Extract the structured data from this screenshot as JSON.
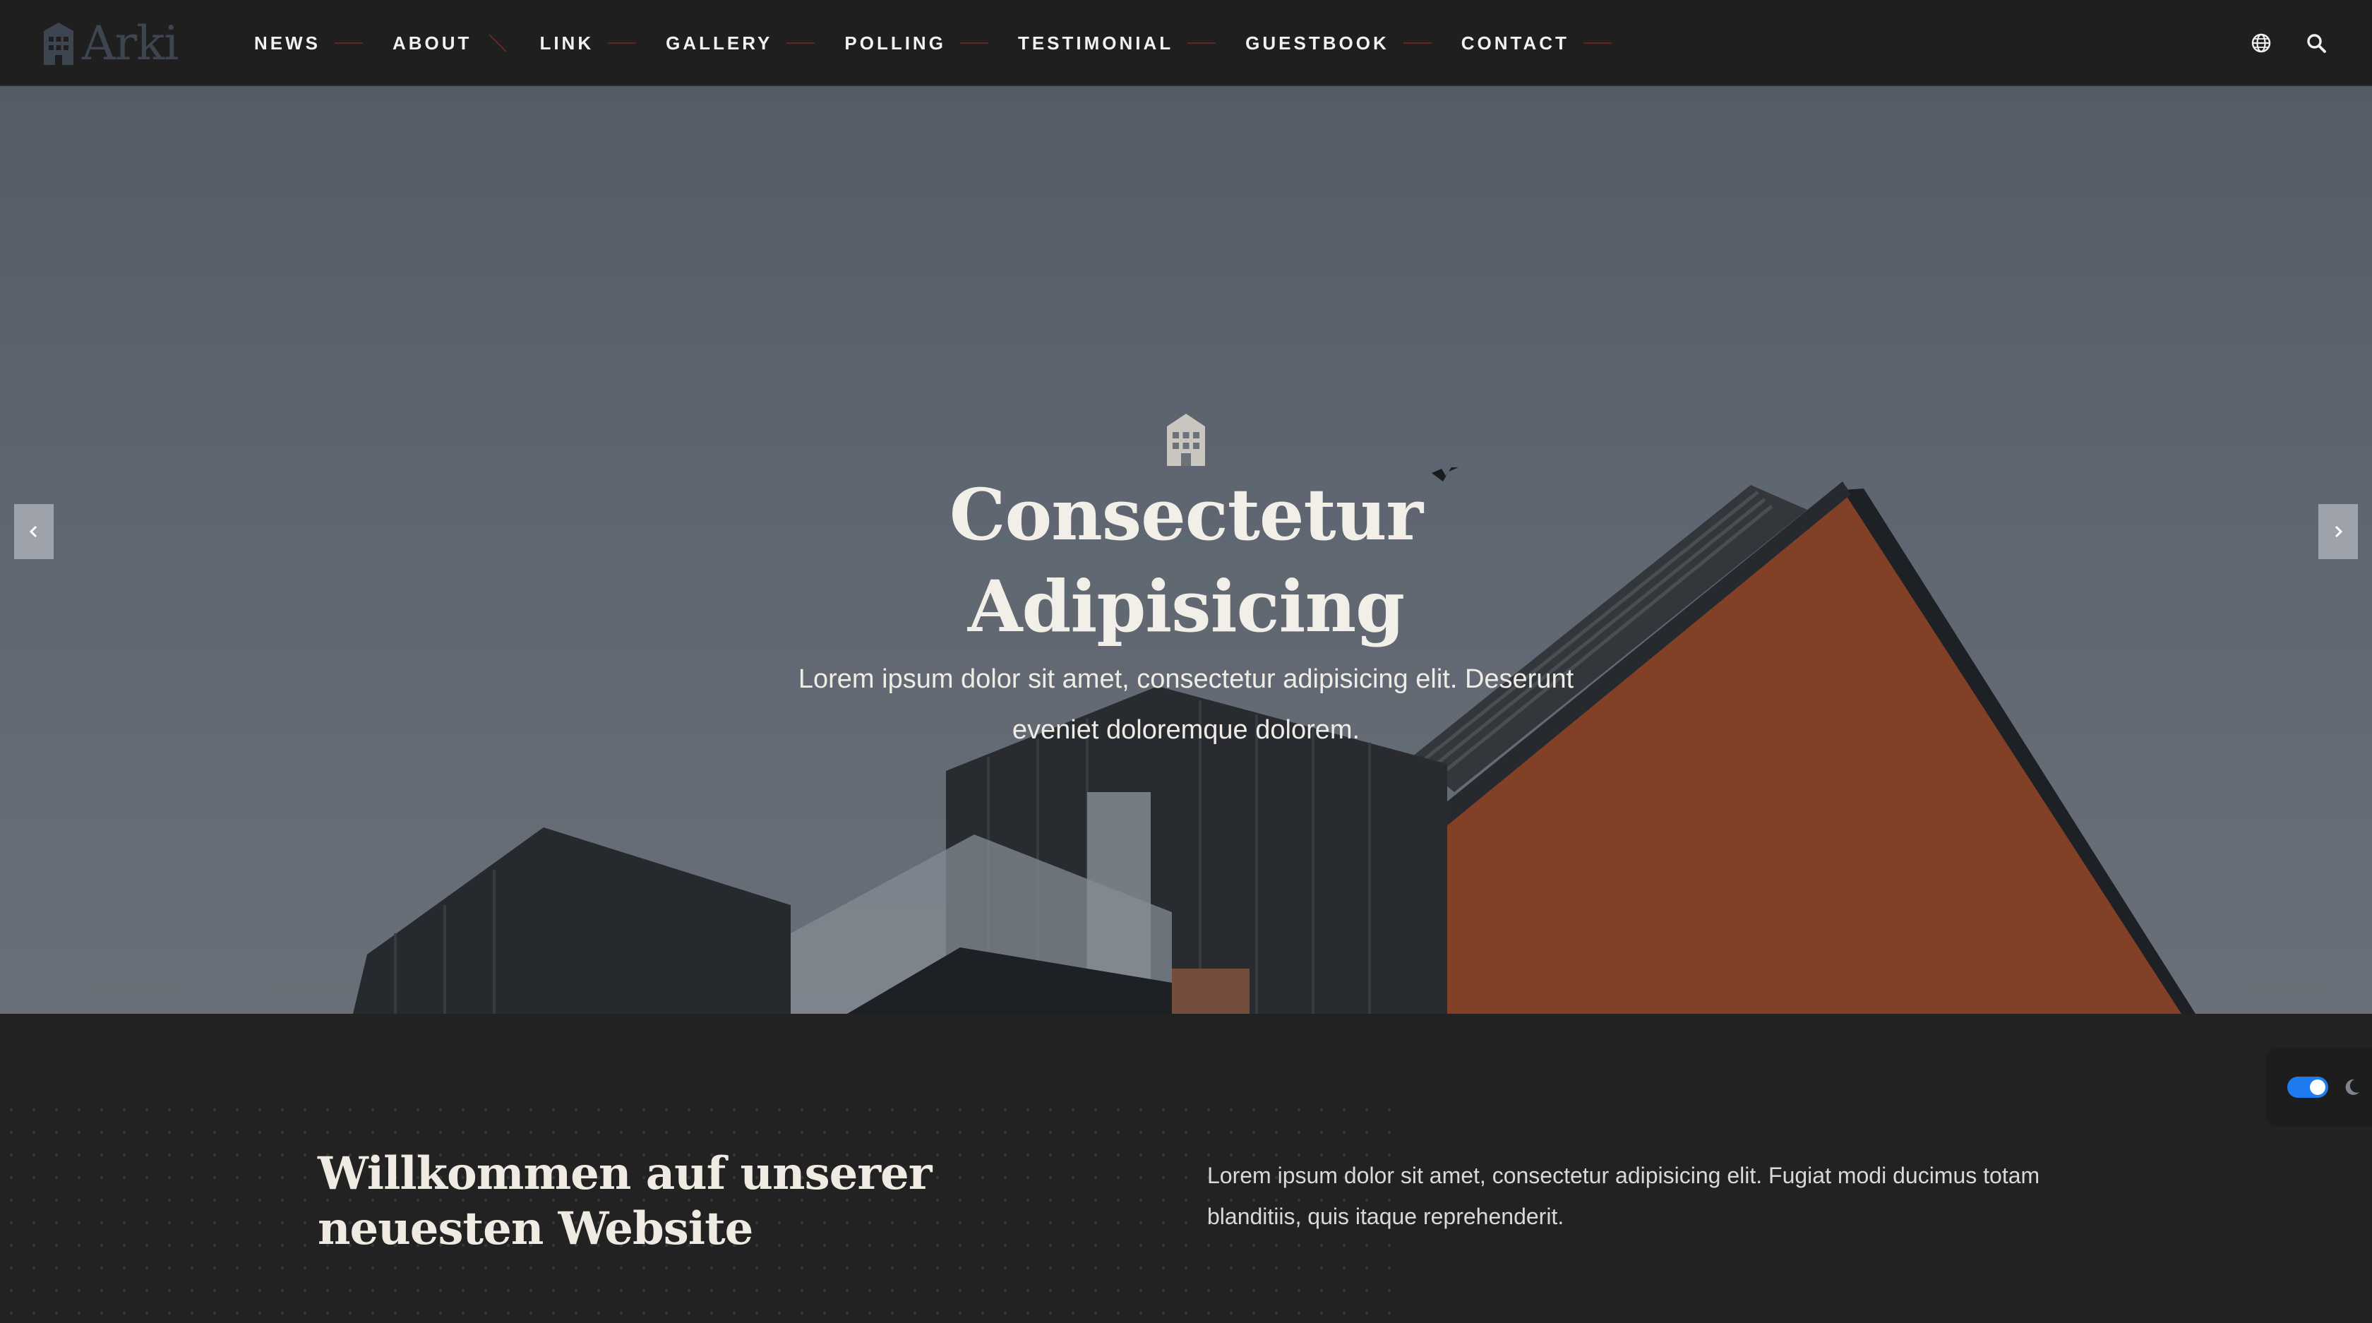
{
  "header": {
    "logo_text": "Arki",
    "nav": [
      {
        "label": "NEWS"
      },
      {
        "label": "ABOUT"
      },
      {
        "label": "LINK"
      },
      {
        "label": "GALLERY"
      },
      {
        "label": "POLLING"
      },
      {
        "label": "TESTIMONIAL"
      },
      {
        "label": "GUESTBOOK"
      },
      {
        "label": "CONTACT"
      }
    ],
    "icons": {
      "language": "globe-icon",
      "search": "search-icon"
    }
  },
  "hero": {
    "icon": "building-icon",
    "title": "Consectetur Adipisicing",
    "text": "Lorem ipsum dolor sit amet, consectetur adipisicing elit. Deserunt eveniet doloremque dolorem.",
    "prev_icon": "chevron-left-icon",
    "next_icon": "chevron-right-icon"
  },
  "welcome": {
    "title": "Willkommen auf unserer neuesten Website",
    "text": "Lorem ipsum dolor sit amet, consectetur adipisicing elit. Fugiat modi ducimus totam blanditiis, quis itaque reprehenderit."
  },
  "theme": {
    "dark_mode": true,
    "icon": "moon-icon",
    "accent": "#1e7cf0"
  },
  "colors": {
    "header_bg": "#1f1f1f",
    "page_bg": "#222222",
    "nav_separator": "#6a2323"
  }
}
